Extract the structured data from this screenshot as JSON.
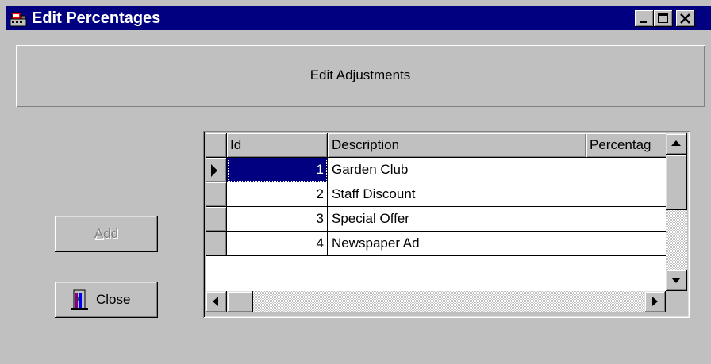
{
  "window": {
    "title": "Edit Percentages",
    "title_icon": "cash-register-icon"
  },
  "header": {
    "text": "Edit Adjustments"
  },
  "buttons": {
    "add_label": "Add",
    "add_enabled": false,
    "close_label": "Close",
    "close_icon": "door-exit-icon"
  },
  "grid": {
    "columns": [
      "Id",
      "Description",
      "Percentag"
    ],
    "rows": [
      {
        "id": "1",
        "description": "Garden Club",
        "percentage": "",
        "current": true
      },
      {
        "id": "2",
        "description": "Staff Discount",
        "percentage": "",
        "current": false
      },
      {
        "id": "3",
        "description": "Special Offer",
        "percentage": "",
        "current": false
      },
      {
        "id": "4",
        "description": "Newspaper Ad",
        "percentage": "",
        "current": false
      }
    ]
  },
  "colors": {
    "titlebar": "#000080",
    "face": "#c0c0c0",
    "selection": "#000080"
  }
}
